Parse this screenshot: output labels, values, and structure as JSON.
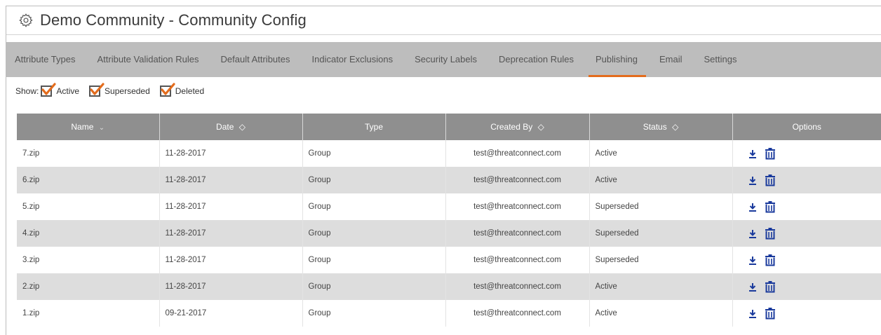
{
  "window": {
    "title": "Demo Community - Community Config",
    "icon": "gear-icon"
  },
  "tabs": [
    {
      "label": "Attribute Types",
      "active": false
    },
    {
      "label": "Attribute Validation Rules",
      "active": false
    },
    {
      "label": "Default Attributes",
      "active": false
    },
    {
      "label": "Indicator Exclusions",
      "active": false
    },
    {
      "label": "Security Labels",
      "active": false
    },
    {
      "label": "Deprecation Rules",
      "active": false
    },
    {
      "label": "Publishing",
      "active": true
    },
    {
      "label": "Email",
      "active": false
    },
    {
      "label": "Settings",
      "active": false
    }
  ],
  "filters": {
    "label": "Show:",
    "options": [
      {
        "label": "Active",
        "checked": true
      },
      {
        "label": "Superseded",
        "checked": true
      },
      {
        "label": "Deleted",
        "checked": true
      }
    ]
  },
  "table": {
    "columns": [
      {
        "label": "Name",
        "sort": "chevron-down-icon"
      },
      {
        "label": "Date",
        "sort": "sort-icon"
      },
      {
        "label": "Type",
        "sort": ""
      },
      {
        "label": "Created By",
        "sort": "sort-icon"
      },
      {
        "label": "Status",
        "sort": "sort-icon"
      },
      {
        "label": "Options",
        "sort": ""
      }
    ],
    "rows": [
      {
        "name": "7.zip",
        "date": "11-28-2017",
        "type": "Group",
        "created_by": "test@threatconnect.com",
        "status": "Active"
      },
      {
        "name": "6.zip",
        "date": "11-28-2017",
        "type": "Group",
        "created_by": "test@threatconnect.com",
        "status": "Active"
      },
      {
        "name": "5.zip",
        "date": "11-28-2017",
        "type": "Group",
        "created_by": "test@threatconnect.com",
        "status": "Superseded"
      },
      {
        "name": "4.zip",
        "date": "11-28-2017",
        "type": "Group",
        "created_by": "test@threatconnect.com",
        "status": "Superseded"
      },
      {
        "name": "3.zip",
        "date": "11-28-2017",
        "type": "Group",
        "created_by": "test@threatconnect.com",
        "status": "Superseded"
      },
      {
        "name": "2.zip",
        "date": "11-28-2017",
        "type": "Group",
        "created_by": "test@threatconnect.com",
        "status": "Active"
      },
      {
        "name": "1.zip",
        "date": "09-21-2017",
        "type": "Group",
        "created_by": "test@threatconnect.com",
        "status": "Active"
      }
    ],
    "row_icons": [
      "download-icon",
      "delete-icon"
    ]
  },
  "colors": {
    "accent": "#e36c1d",
    "tab_bar": "#bdbdbd",
    "header": "#8f8f8f",
    "alt_row": "#dddddd",
    "icon_blue": "#1a3a9c"
  }
}
